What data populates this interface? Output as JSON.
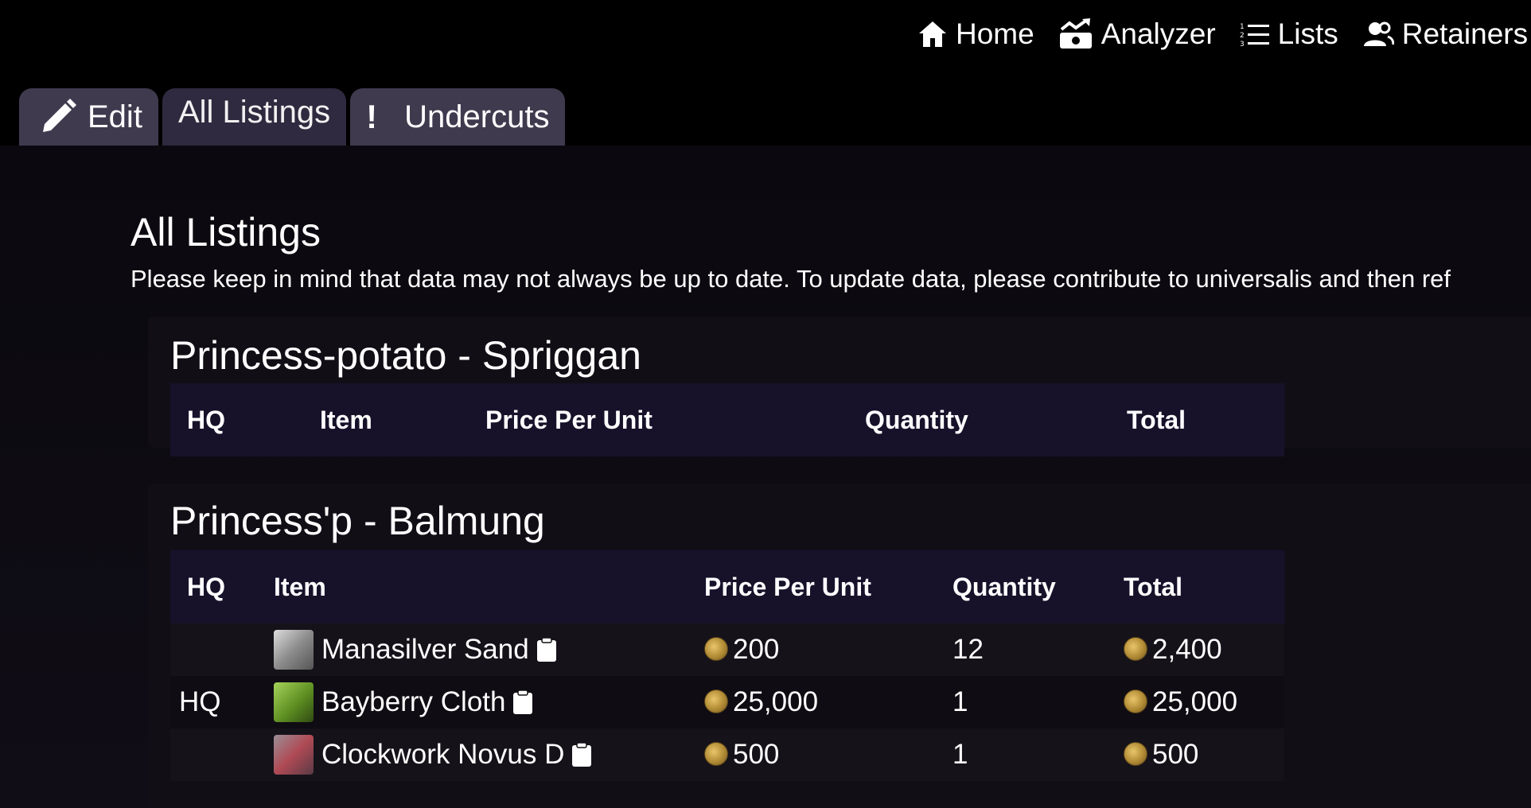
{
  "nav": {
    "home": "Home",
    "analyzer": "Analyzer",
    "lists": "Lists",
    "retainers": "Retainers"
  },
  "tabs": {
    "edit": "Edit",
    "all_listings": "All Listings",
    "undercuts_bang": "!",
    "undercuts": "Undercuts"
  },
  "page": {
    "title": "All Listings",
    "note": "Please keep in mind that data may not always be up to date. To update data, please contribute to universalis and then ref"
  },
  "columns": {
    "hq": "HQ",
    "item": "Item",
    "price": "Price Per Unit",
    "quantity": "Quantity",
    "total": "Total"
  },
  "retainers": [
    {
      "title": "Princess-potato - Spriggan",
      "rows": []
    },
    {
      "title": "Princess'p - Balmung",
      "rows": [
        {
          "hq": "",
          "item": "Manasilver Sand",
          "price": "200",
          "quantity": "12",
          "total": "2,400"
        },
        {
          "hq": "HQ",
          "item": "Bayberry Cloth",
          "price": "25,000",
          "quantity": "1",
          "total": "25,000"
        },
        {
          "hq": "",
          "item": "Clockwork Novus D",
          "price": "500",
          "quantity": "1",
          "total": "500"
        }
      ]
    }
  ],
  "colors": {
    "tab_bg": "#3f3a4e",
    "table_header_bg": "#17122a",
    "coin": "#c9a24b"
  }
}
